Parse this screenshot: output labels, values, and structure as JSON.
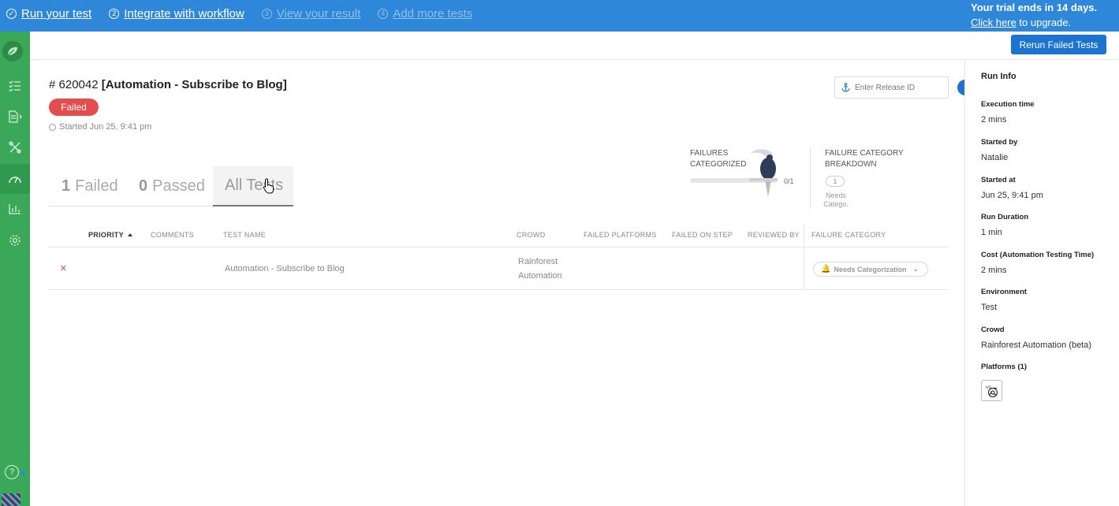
{
  "banner": {
    "steps": [
      {
        "num": "✓",
        "label": "Run your test",
        "state": "done"
      },
      {
        "num": "2",
        "label": "Integrate with workflow",
        "state": "done"
      },
      {
        "num": "3",
        "label": "View your result",
        "state": "dim"
      },
      {
        "num": "4",
        "label": "Add more tests",
        "state": "dim"
      }
    ],
    "trial_line": "Your trial ends in 14 days.",
    "upgrade_link": "Click here",
    "upgrade_rest": " to upgrade."
  },
  "sidebar": {
    "icons": [
      "leaf-logo-icon",
      "list-check-icon",
      "document-icon",
      "tools-icon",
      "dashboard-gauge-icon",
      "bar-chart-icon",
      "gear-icon",
      "help-icon",
      "avatar"
    ]
  },
  "toolbar": {
    "rerun_label": "Rerun Failed Tests"
  },
  "run": {
    "number": "# 620042 ",
    "name": "[Automation - Subscribe to Blog]",
    "status": "Failed",
    "started": "Started Jun 25, 9:41 pm",
    "release_placeholder": "Enter Release ID"
  },
  "tabs": [
    {
      "count": "1",
      "label": "Failed"
    },
    {
      "count": "0",
      "label": "Passed"
    },
    {
      "count": "",
      "label": "All Tests"
    }
  ],
  "failures": {
    "label_line1": "FAILURES",
    "label_line2": "CATEGORIZED",
    "count": "0/1",
    "progress": 0,
    "breakdown_line1": "FAILURE CATEGORY",
    "breakdown_line2": "BREAKDOWN",
    "breakdown_count": "1",
    "breakdown_sub_line1": "Needs",
    "breakdown_sub_line2": "Catego."
  },
  "table": {
    "headers": {
      "priority": "PRIORITY",
      "comments": "COMMENTS",
      "test_name": "TEST NAME",
      "crowd": "CROWD",
      "failed_platforms": "FAILED PLATFORMS",
      "failed_on_step": "FAILED ON STEP",
      "reviewed_by": "REVIEWED BY",
      "failure_category": "FAILURE CATEGORY"
    },
    "rows": [
      {
        "status_icon": "×",
        "test_name": "Automation - Subscribe to Blog",
        "crowd_line1": "Rainforest",
        "crowd_line2": "Automation",
        "category": "Needs Categorization"
      }
    ]
  },
  "run_info": {
    "title": "Run Info",
    "fields": [
      {
        "label": "Execution time",
        "value": "2 mins"
      },
      {
        "label": "Started by",
        "value": "Natalie"
      },
      {
        "label": "Started at",
        "value": "Jun 25, 9:41 pm"
      },
      {
        "label": "Run Duration",
        "value": "1 min"
      },
      {
        "label": "Cost (Automation Testing Time)",
        "value": "2 mins"
      },
      {
        "label": "Environment",
        "value": "Test"
      },
      {
        "label": "Crowd",
        "value": "Rainforest Automation (beta)"
      }
    ],
    "platforms_label": "Platforms (1)",
    "platform_icon": "chrome-hd-icon"
  },
  "colors": {
    "banner": "#2e87d8",
    "sidebar": "#3aa858",
    "primary_button": "#1d74d0",
    "failed": "#e24e4e"
  }
}
